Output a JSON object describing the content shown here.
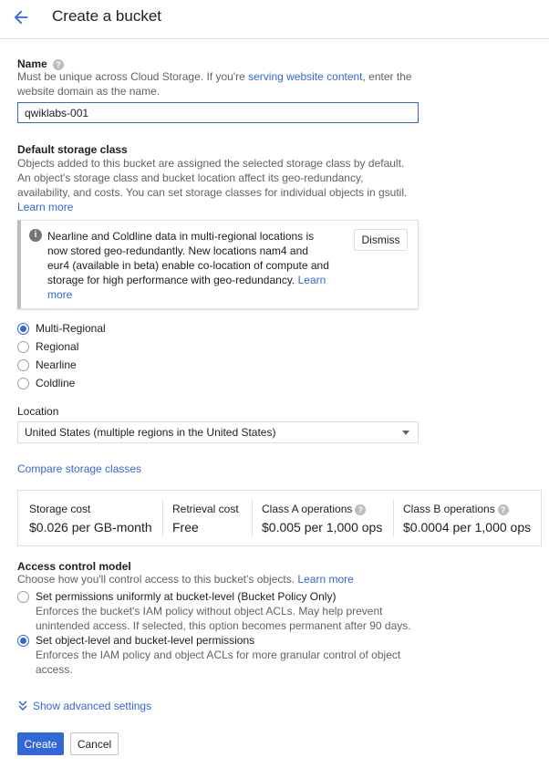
{
  "header": {
    "title": "Create a bucket",
    "back_icon": "arrow-back-icon"
  },
  "name_section": {
    "title": "Name",
    "help_prefix": "Must be unique across Cloud Storage. If you're ",
    "help_link": "serving website content",
    "help_suffix": ", enter the website domain as the name.",
    "value": "qwiklabs-001"
  },
  "storage_class": {
    "title": "Default storage class",
    "description": "Objects added to this bucket are assigned the selected storage class by default. An object's storage class and bucket location affect its geo-redundancy, availability, and costs. You can set storage classes for individual objects in gsutil.",
    "learn_more": "Learn more",
    "notice": {
      "text": "Nearline and Coldline data in multi-regional locations is now stored geo-redundantly. New locations nam4 and eur4 (available in beta) enable co-location of compute and storage for high performance with geo-redundancy.",
      "learn_more": "Learn more",
      "dismiss": "Dismiss"
    },
    "options": [
      {
        "label": "Multi-Regional",
        "checked": true
      },
      {
        "label": "Regional",
        "checked": false
      },
      {
        "label": "Nearline",
        "checked": false
      },
      {
        "label": "Coldline",
        "checked": false
      }
    ]
  },
  "location": {
    "title": "Location",
    "selected": "United States (multiple regions in the United States)"
  },
  "compare_link": "Compare storage classes",
  "costs": [
    {
      "label": "Storage cost",
      "value": "$0.026 per GB-month",
      "help": false
    },
    {
      "label": "Retrieval cost",
      "value": "Free",
      "help": false
    },
    {
      "label": "Class A operations",
      "value": "$0.005 per 1,000 ops",
      "help": true
    },
    {
      "label": "Class B operations",
      "value": "$0.0004 per 1,000 ops",
      "help": true
    }
  ],
  "access_control": {
    "title": "Access control model",
    "description": "Choose how you'll control access to this bucket's objects.",
    "learn_more": "Learn more",
    "options": [
      {
        "label": "Set permissions uniformly at bucket-level (Bucket Policy Only)",
        "description": "Enforces the bucket's IAM policy without object ACLs. May help prevent unintended access. If selected, this option becomes permanent after 90 days.",
        "checked": false
      },
      {
        "label": "Set object-level and bucket-level permissions",
        "description": "Enforces the IAM policy and object ACLs for more granular control of object access.",
        "checked": true
      }
    ]
  },
  "advanced_link": "Show advanced settings",
  "buttons": {
    "create": "Create",
    "cancel": "Cancel"
  },
  "colors": {
    "accent": "#3367d6",
    "text": "#212121",
    "muted": "#5f6368"
  }
}
